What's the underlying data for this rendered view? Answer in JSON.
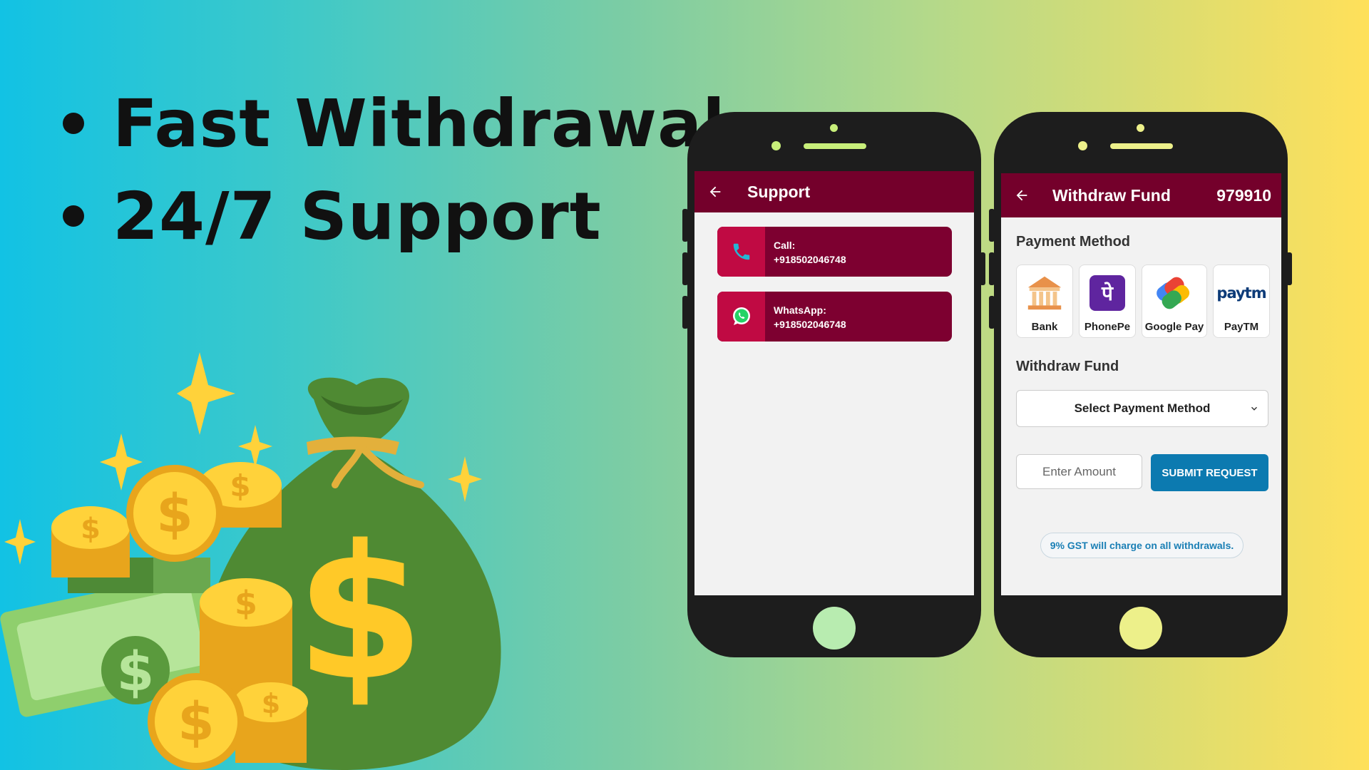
{
  "headline": {
    "bullets": [
      "Fast Withdrawal",
      "24/7 Support"
    ]
  },
  "colors": {
    "appbar": "#74002b",
    "contact_card": "#7d0030",
    "contact_icon_bg": "#c00a43",
    "submit": "#0c7ab0",
    "phone_accent_left": "#b8ecb0",
    "phone_accent_right": "#edf08a"
  },
  "support_screen": {
    "title": "Support",
    "contacts": [
      {
        "icon": "phone-icon",
        "label": "Call:",
        "value": "+918502046748"
      },
      {
        "icon": "whatsapp-icon",
        "label": "WhatsApp:",
        "value": "+918502046748"
      }
    ]
  },
  "withdraw_screen": {
    "title": "Withdraw Fund",
    "balance": "979910",
    "payment_method_label": "Payment Method",
    "methods": [
      {
        "label": "Bank",
        "icon": "bank-icon"
      },
      {
        "label": "PhonePe",
        "icon": "phonepe-icon"
      },
      {
        "label": "Google Pay",
        "icon": "google-pay-icon"
      },
      {
        "label": "PayTM",
        "icon": "paytm-icon"
      }
    ],
    "paytm_logo_text": "paytm",
    "phonepe_logo_text": "पे",
    "withdraw_fund_label": "Withdraw Fund",
    "select_placeholder": "Select Payment Method",
    "amount_placeholder": "Enter Amount",
    "submit_label": "SUBMIT REQUEST",
    "gst_note": "9% GST will charge on all withdrawals."
  }
}
